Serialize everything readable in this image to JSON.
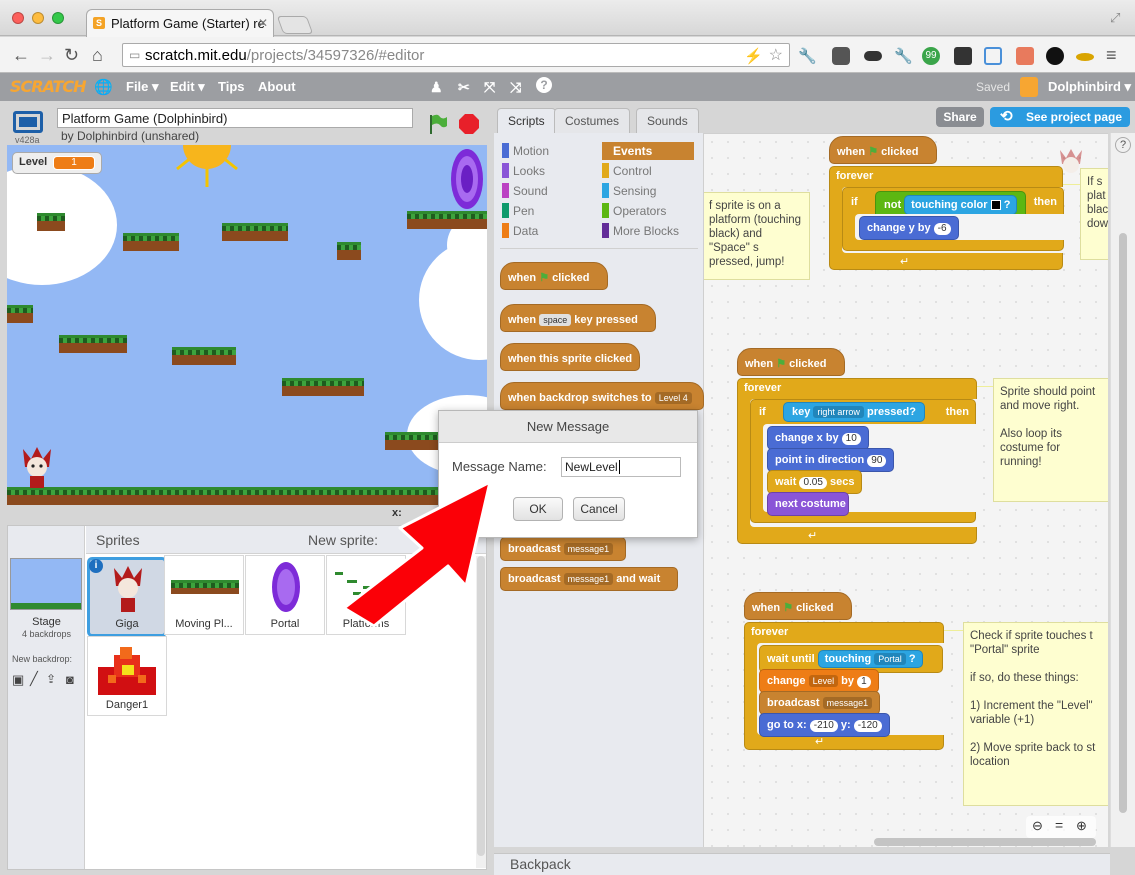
{
  "browser": {
    "tab_title": "Platform Game (Starter) re",
    "tab_favicon": "S",
    "url_domain": "scratch.mit.edu",
    "url_path": "/projects/34597326/#editor"
  },
  "menubar": {
    "logo": "SCRATCH",
    "items": [
      "File ▾",
      "Edit ▾",
      "Tips",
      "About"
    ],
    "saved": "Saved",
    "user": "Dolphinbird ▾",
    "accent": "#f7a632"
  },
  "stage": {
    "version": "v428a",
    "project_title": "Platform Game (Dolphinbird)",
    "author": "by Dolphinbird (unshared)",
    "variable_label": "Level",
    "variable_value": "1",
    "coord_label": "x:"
  },
  "sprites": {
    "header": "Sprites",
    "new_sprite": "New sprite:",
    "stage_label": "Stage",
    "stage_backdrops": "4 backdrops",
    "new_backdrop": "New backdrop:",
    "items": [
      "Giga",
      "Moving Pl...",
      "Portal",
      "Platforms",
      "Danger1"
    ]
  },
  "tabs": [
    "Scripts",
    "Costumes",
    "Sounds"
  ],
  "project_buttons": {
    "share": "Share",
    "see_page": "See project page"
  },
  "categories": {
    "left": [
      "Motion",
      "Looks",
      "Sound",
      "Pen",
      "Data"
    ],
    "right": [
      "Events",
      "Control",
      "Sensing",
      "Operators",
      "More Blocks"
    ]
  },
  "palette": {
    "when": "when",
    "clicked": "clicked",
    "key_space": "space",
    "key_pressed": "key pressed",
    "when_this_sprite_clicked": "when this sprite clicked",
    "when_backdrop_switches": "when backdrop switches to",
    "backdrop_value": "Level 4",
    "broadcast": "broadcast",
    "message": "message1",
    "and_wait": "and wait"
  },
  "scripts": {
    "s1": {
      "forever": "forever",
      "if": "if",
      "not": "not",
      "touching_color": "touching color",
      "q": "?",
      "then": "then",
      "change_y": "change y by",
      "y_val": "-6"
    },
    "s2": {
      "forever": "forever",
      "if": "if",
      "key": "key",
      "key_val": "right arrow",
      "pressed": "pressed?",
      "then": "then",
      "change_x": "change x by",
      "x_val": "10",
      "point_dir": "point in direction",
      "dir_val": "90",
      "wait": "wait",
      "wait_val": "0.05",
      "secs": "secs",
      "next_costume": "next costume"
    },
    "s3": {
      "forever": "forever",
      "wait_until": "wait until",
      "touching": "touching",
      "portal": "Portal",
      "q": "?",
      "change": "change",
      "level": "Level",
      "by": "by",
      "by_val": "1",
      "broadcast": "broadcast",
      "message": "message1",
      "goto": "go to x:",
      "x_val": "-210",
      "y_label": "y:",
      "y_val": "-120"
    }
  },
  "notes": {
    "n1": "f sprite is on a platform (touching black) and \"Space\" s pressed, jump!",
    "n2": "If s plat blac dow",
    "n3": "Sprite should point and move right.\n\nAlso loop its costume for running!",
    "n4": "Check if sprite touches t \"Portal\" sprite\n\nif so, do these things:\n\n1) Increment the \"Level\" variable (+1)\n\n2) Move sprite back to st location"
  },
  "dialog": {
    "title": "New Message",
    "label": "Message Name:",
    "value": "NewLevel",
    "ok": "OK",
    "cancel": "Cancel"
  },
  "backpack": "Backpack"
}
